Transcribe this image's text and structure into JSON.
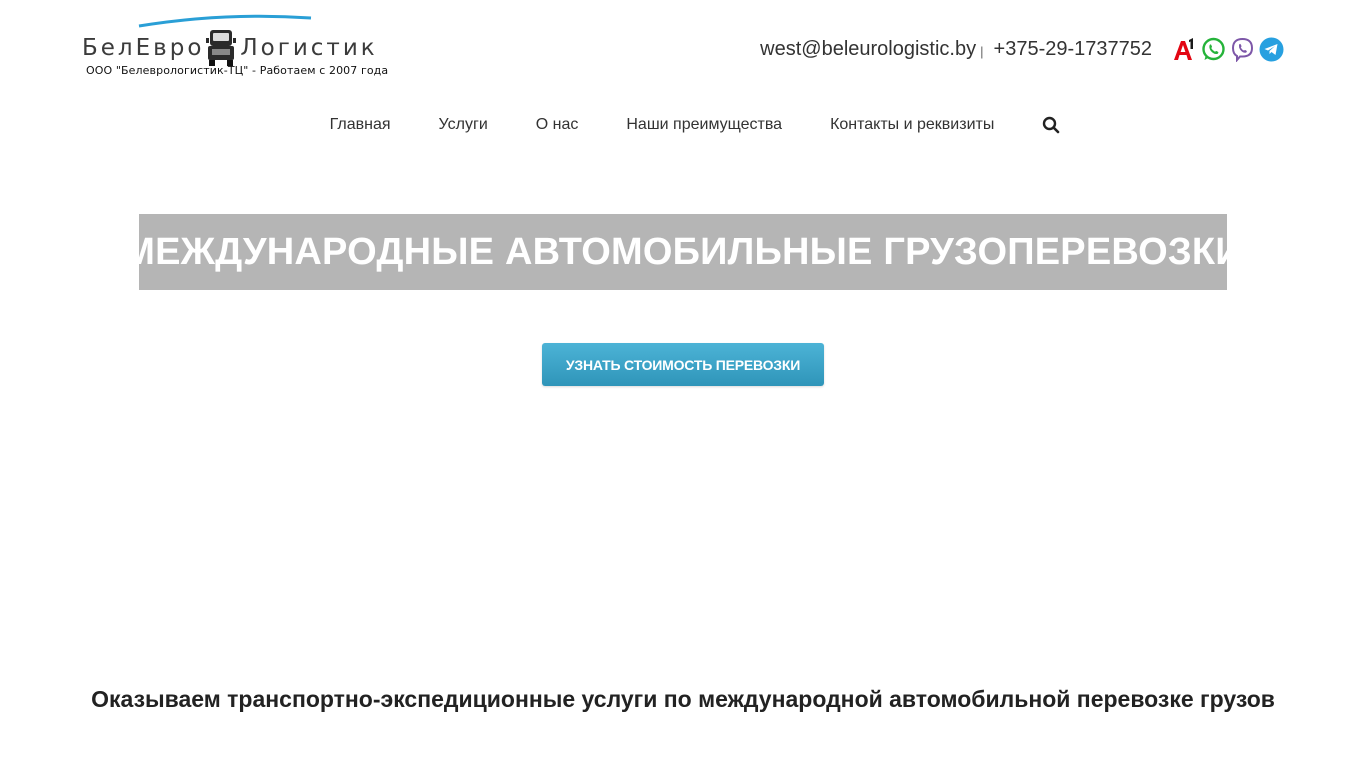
{
  "brand": {
    "name_left": "БелЕвро",
    "name_right": "Логистик",
    "subtitle": "ООО \"Белеврологистик-ТЦ\" - Работаем с 2007 года",
    "icon": "truck-icon",
    "accent_color": "#2a9fd6"
  },
  "contacts": {
    "email": "west@beleurologistic.by",
    "separator": "|",
    "phone": "+375-29-1737752",
    "messengers": [
      {
        "name": "a1-icon",
        "color": "#e30613"
      },
      {
        "name": "whatsapp-icon",
        "color": "#25b33a"
      },
      {
        "name": "viber-icon",
        "color": "#7d57a8"
      },
      {
        "name": "telegram-icon",
        "color": "#27a0e0"
      }
    ]
  },
  "nav": {
    "items": [
      {
        "label": "Главная"
      },
      {
        "label": "Услуги"
      },
      {
        "label": "О нас"
      },
      {
        "label": "Наши преимущества"
      },
      {
        "label": "Контакты и реквизиты"
      }
    ],
    "search_icon": "search-icon"
  },
  "hero": {
    "title": "МЕЖДУНАРОДНЫЕ АВТОМОБИЛЬНЫЕ ГРУЗОПЕРЕВОЗКИ",
    "background": "#b5b5b5",
    "cta_label": "УЗНАТЬ СТОИМОСТЬ ПЕРЕВОЗКИ",
    "cta_color": "#3aa3c8"
  },
  "section": {
    "heading": "Оказываем транспортно-экспедиционные услуги по международной автомобильной перевозке грузов"
  }
}
